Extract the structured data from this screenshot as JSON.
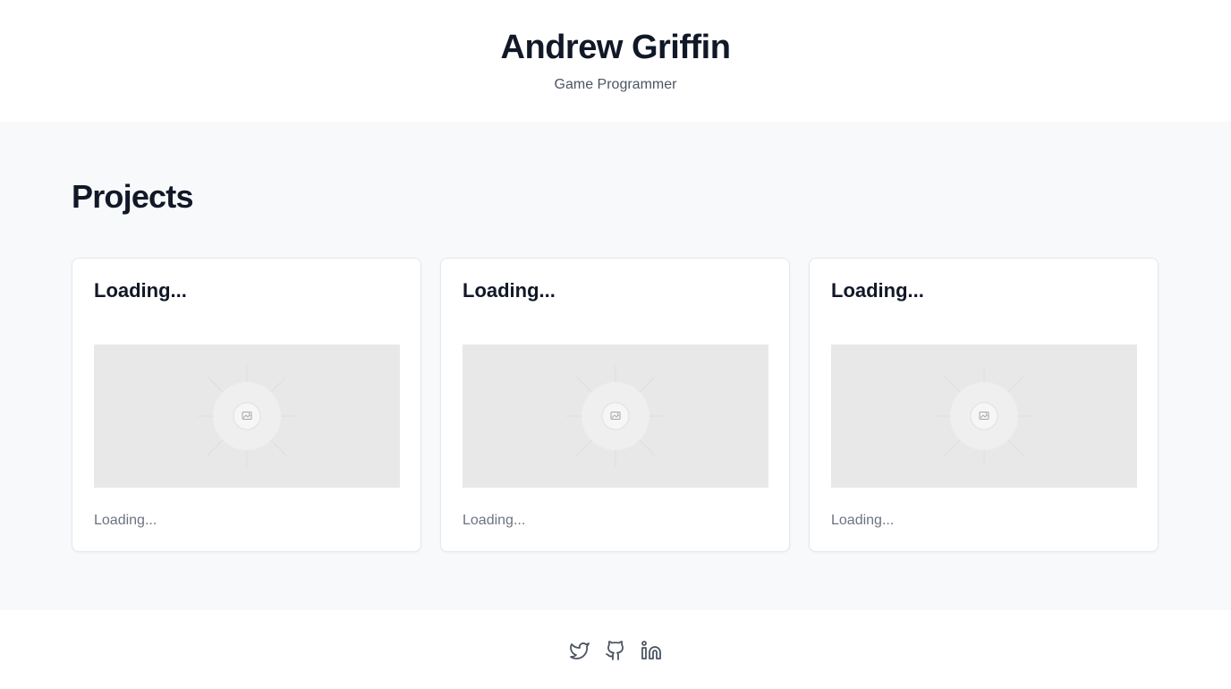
{
  "header": {
    "name": "Andrew Griffin",
    "subtitle": "Game Programmer"
  },
  "projects": {
    "title": "Projects",
    "cards": [
      {
        "title": "Loading...",
        "description": "Loading...",
        "image_icon": "image-placeholder-icon"
      },
      {
        "title": "Loading...",
        "description": "Loading...",
        "image_icon": "image-placeholder-icon"
      },
      {
        "title": "Loading...",
        "description": "Loading...",
        "image_icon": "image-placeholder-icon"
      }
    ]
  },
  "footer": {
    "links": [
      {
        "icon": "twitter-icon"
      },
      {
        "icon": "github-icon"
      },
      {
        "icon": "linkedin-icon"
      }
    ],
    "icon_color": "#4b5563"
  }
}
